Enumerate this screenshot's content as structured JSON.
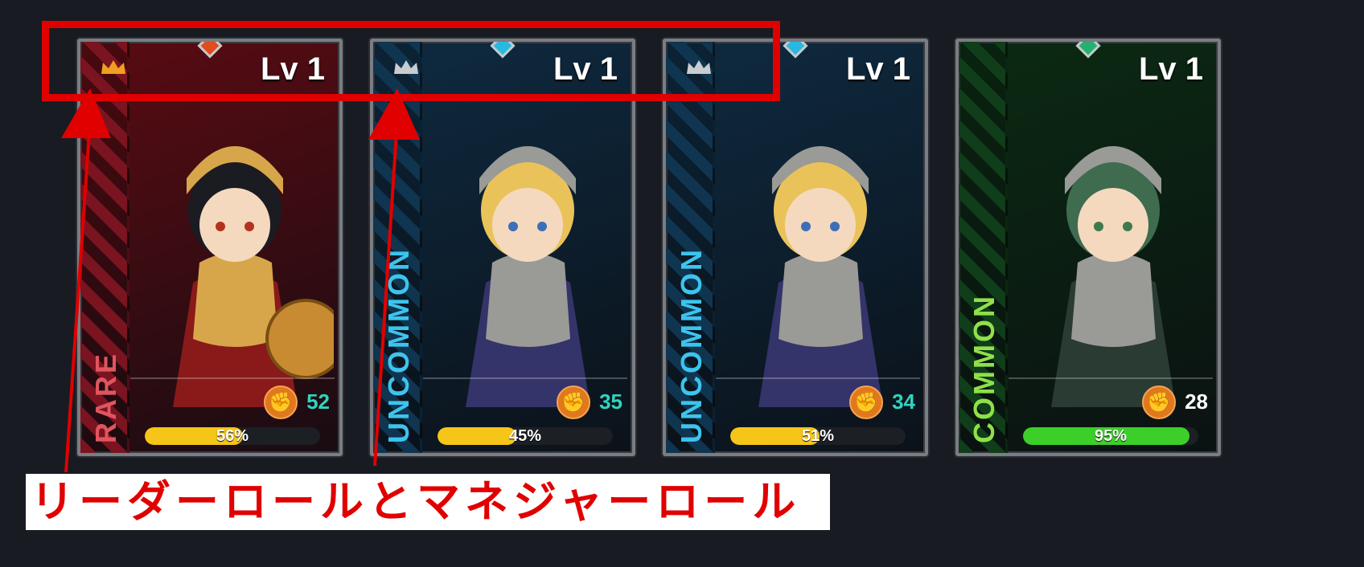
{
  "cards": [
    {
      "level": "Lv 1",
      "rarity": "RARE",
      "power": "52",
      "progress_label": "56%",
      "progress": 0.56,
      "colors": {
        "bg": "#5a0b12",
        "strip": "#7a1420",
        "rarity": "#e0555f",
        "gem": "#e04b1f",
        "crown": "#f0a020",
        "power": "#2fd4c0",
        "bar": "#f5c518"
      }
    },
    {
      "level": "Lv 1",
      "rarity": "UNCOMMON",
      "power": "35",
      "progress_label": "45%",
      "progress": 0.45,
      "colors": {
        "bg": "#0e2a40",
        "strip": "#0f3550",
        "rarity": "#3cc4ee",
        "gem": "#2ab8e0",
        "crown": "#c9ccd0",
        "power": "#2fd4c0",
        "bar": "#f5c518"
      }
    },
    {
      "level": "Lv 1",
      "rarity": "UNCOMMON",
      "power": "34",
      "progress_label": "51%",
      "progress": 0.51,
      "colors": {
        "bg": "#0e2a40",
        "strip": "#0f3550",
        "rarity": "#3cc4ee",
        "gem": "#2ab8e0",
        "crown": "#c9ccd0",
        "power": "#2fd4c0",
        "bar": "#f5c518"
      }
    },
    {
      "level": "Lv 1",
      "rarity": "COMMON",
      "power": "28",
      "progress_label": "95%",
      "progress": 0.95,
      "colors": {
        "bg": "#0b2a12",
        "strip": "#103d1a",
        "rarity": "#8fe04a",
        "gem": "#25b070",
        "crown": "",
        "power": "#ffffff",
        "bar": "#3ccf2a"
      }
    }
  ],
  "annotation": {
    "label": "リーダーロールとマネジャーロール",
    "color": "#e00000"
  },
  "icons": {
    "crown": "crown-icon",
    "power": "fist-icon",
    "gem": "gem-icon"
  }
}
